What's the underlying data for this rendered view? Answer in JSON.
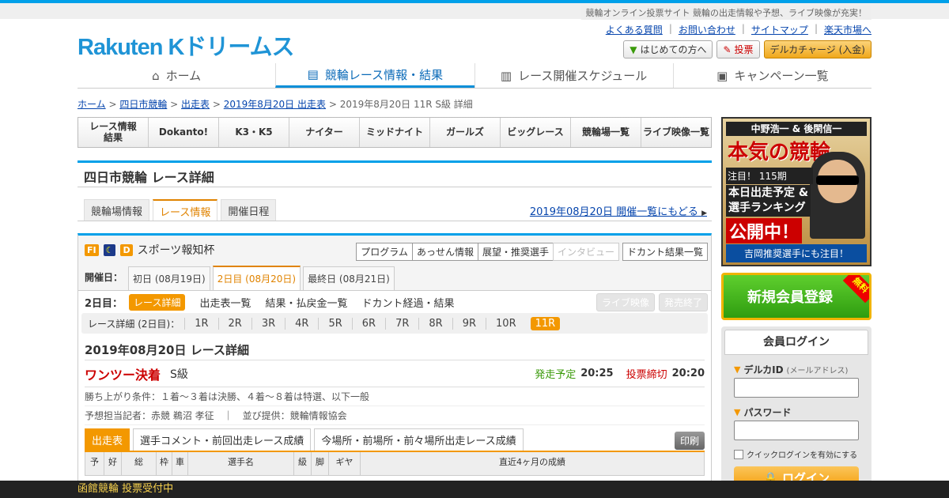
{
  "header": {
    "tagline": "競輪オンライン投票サイト 競輪の出走情報や予想、ライブ映像が充実！",
    "logo": "Rakuten Kドリームス",
    "links": [
      "よくある質問",
      "お問い合わせ",
      "サイトマップ",
      "楽天市場へ"
    ],
    "buttons": {
      "beginner": "はじめての方へ",
      "vote": "投票",
      "charge": "デルカチャージ (入金)"
    }
  },
  "nav": [
    "ホーム",
    "競輪レース情報・結果",
    "レース開催スケジュール",
    "キャンペーン一覧"
  ],
  "breadcrumb": {
    "home": "ホーム",
    "venue": "四日市競輪",
    "list": "出走表",
    "date": "2019年8月20日 出走表",
    "current": "2019年8月20日 11R S級 詳細"
  },
  "catbar": [
    "レース情報\n結果",
    "Dokanto!",
    "K3・K5",
    "ナイター",
    "ミッドナイト",
    "ガールズ",
    "ビッグレース",
    "競輪場一覧",
    "ライブ映像一覧"
  ],
  "title": "四日市競輪 レース詳細",
  "subtabs": [
    "競輪場情報",
    "レース情報",
    "開催日程"
  ],
  "backlink": "2019年08月20日 開催一覧にもどる",
  "race": {
    "badge1": "FI",
    "badge2": "D",
    "name": "スポーツ報知杯",
    "btns": [
      "プログラム",
      "あっせん情報",
      "展望・推奨選手",
      "インタビュー",
      "ドカント結果一覧"
    ],
    "days_label": "開催日：",
    "days": [
      "初日 (08月19日)",
      "2日目 (08月20日)",
      "最終日 (08月21日)"
    ],
    "day2_label": "2日目：",
    "day2_items": [
      "レース詳細",
      "出走表一覧",
      "結果・払戻金一覧",
      "ドカント経過・結果"
    ],
    "gray": [
      "ライブ映像",
      "発売終了"
    ],
    "races_label": "レース詳細 (2日目)：",
    "races": [
      "1R",
      "2R",
      "3R",
      "4R",
      "5R",
      "6R",
      "7R",
      "8R",
      "9R",
      "10R",
      "11R"
    ],
    "heading": "2019年08月20日 レース詳細",
    "type": "ワンツー決着",
    "grade": "S級",
    "start_label": "発走予定",
    "start": "20:25",
    "close_label": "投票締切",
    "close": "20:20",
    "cond": "勝ち上がり条件：１着～３着は決勝、４着～８着は特選、以下一般",
    "reporter": "予想担当記者：赤競 鵜沼 孝征　｜　並び提供：競輪情報協会",
    "tabs": [
      "出走表",
      "選手コメント・前回出走レース成績",
      "今場所・前場所・前々場所出走レース成績"
    ],
    "print": "印刷",
    "cols": [
      "予",
      "好",
      "総",
      "枠",
      "車",
      "選手名",
      "級",
      "脚",
      "ギヤ",
      "直近4ヶ月の成績"
    ]
  },
  "side": {
    "b1a": "中野浩一 & 後閑信一",
    "b1b": "本気の競輪",
    "b1c": "注目！ 115期",
    "b1d": "本日出走予定 &\n選手ランキング",
    "b1e": "公開中！",
    "b1f": "吉岡推奨選手にも注目！",
    "b2": "新規会員登録",
    "free": "無料",
    "login": "会員ログイン",
    "id": "デルカID",
    "id_note": "(メールアドレス)",
    "pw": "パスワード",
    "quick": "クイックログインを有効にする",
    "btn": "ログイン"
  },
  "footer": "函館競輪 投票受付中"
}
